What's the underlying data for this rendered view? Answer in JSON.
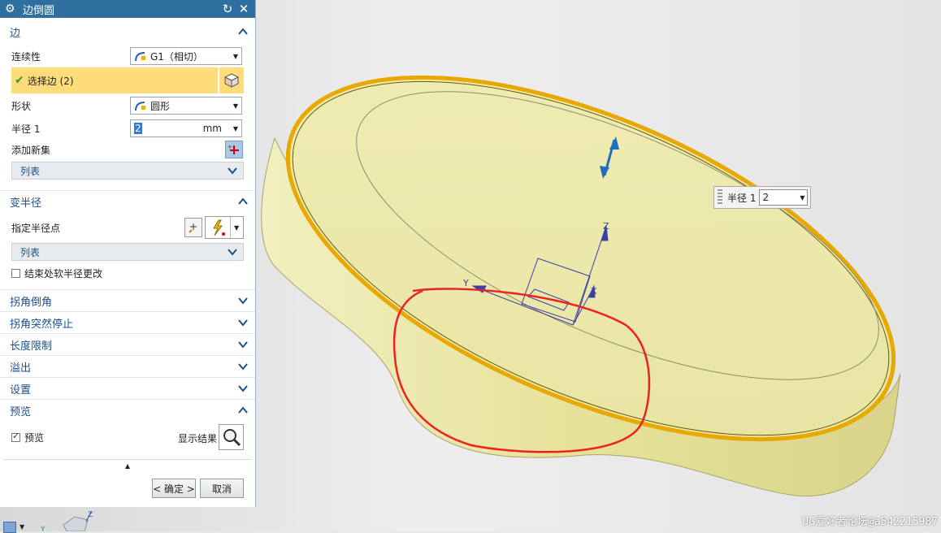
{
  "dialog": {
    "title": "边倒圆",
    "reset_glyph": "↻",
    "close_glyph": "✕",
    "edge_section": {
      "title": "边",
      "continuity_label": "连续性",
      "continuity_value": "G1（相切）",
      "select_edge_label": "选择边 (2)",
      "shape_label": "形状",
      "shape_value": "圆形",
      "radius_label": "半径 1",
      "radius_value": "2",
      "radius_unit": "mm",
      "add_new_set_label": "添加新集",
      "list_label": "列表"
    },
    "variable_radius_section": {
      "title": "变半径",
      "specify_point_label": "指定半径点",
      "list_label": "列表",
      "soft_change_label": "结束处软半径更改",
      "soft_change_checked": false
    },
    "collapsed_sections": [
      {
        "title": "拐角倒角"
      },
      {
        "title": "拐角突然停止"
      },
      {
        "title": "长度限制"
      },
      {
        "title": "溢出"
      },
      {
        "title": "设置"
      }
    ],
    "preview_section": {
      "title": "预览",
      "preview_label": "预览",
      "preview_checked": true,
      "show_result_label": "显示结果"
    },
    "ok_label": "< 确定 >",
    "cancel_label": "取消"
  },
  "viewport": {
    "radius_tooltip_label": "半径 1",
    "radius_tooltip_value": "2",
    "axis_z": "Z",
    "axis_y": "Y",
    "axis_x": "X",
    "triad_z": "Z",
    "triad_y": "Y"
  },
  "watermark": "UG爱好者论坛@a542215987",
  "colors": {
    "title_bar": "#2f6fa0",
    "section_text": "#1b4f85",
    "selection_highlight": "#ffdc7a",
    "model_face": "#ece9a6",
    "edge_highlight": "#e8a800",
    "annotation_red": "#ee2020"
  }
}
